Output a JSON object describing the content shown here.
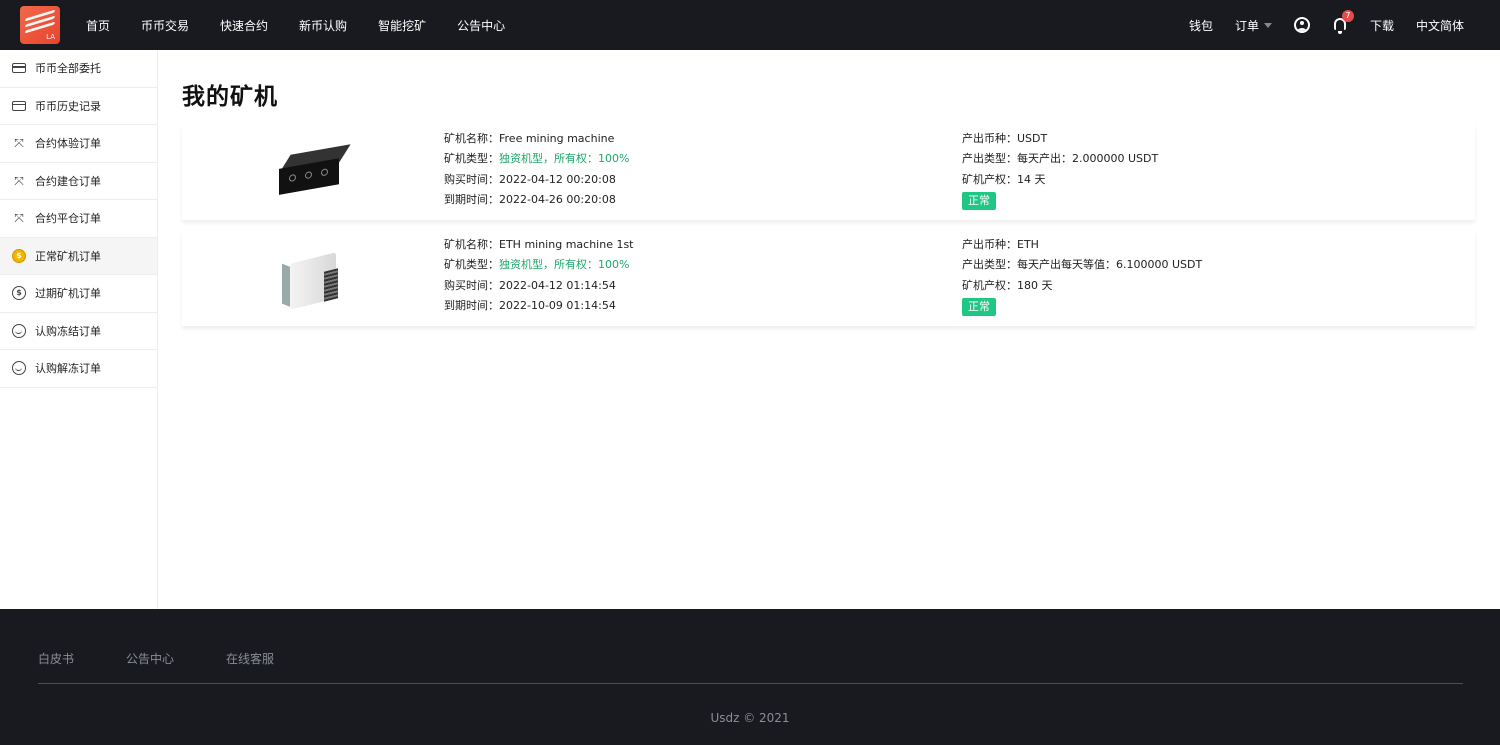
{
  "nav": {
    "logo_text": "LA",
    "links": [
      "首页",
      "币币交易",
      "快速合约",
      "新币认购",
      "智能挖矿",
      "公告中心"
    ],
    "right": {
      "wallet": "钱包",
      "orders": "订单",
      "notifications_count": "7",
      "download": "下载",
      "language": "中文简体"
    }
  },
  "sidebar": {
    "items": [
      {
        "label": "币币全部委托",
        "icon": "card-icon"
      },
      {
        "label": "币币历史记录",
        "icon": "card-icon"
      },
      {
        "label": "合约体验订单",
        "icon": "swap-icon"
      },
      {
        "label": "合约建仓订单",
        "icon": "swap-icon"
      },
      {
        "label": "合约平仓订单",
        "icon": "swap-icon"
      },
      {
        "label": "正常矿机订单",
        "icon": "coin-icon"
      },
      {
        "label": "过期矿机订单",
        "icon": "coin-icon"
      },
      {
        "label": "认购冻结订单",
        "icon": "face-icon"
      },
      {
        "label": "认购解冻订单",
        "icon": "face-icon"
      }
    ],
    "active_index": 5
  },
  "main": {
    "title": "我的矿机",
    "machines": [
      {
        "name_label": "矿机名称：",
        "name": "Free mining machine",
        "type_label": "矿机类型：",
        "type": "独资机型，所有权：100%",
        "buy_label": "购买时间：",
        "buy_time": "2022-04-12 00:20:08",
        "expire_label": "到期时间：",
        "expire_time": "2022-04-26 00:20:08",
        "coin_label": "产出币种：",
        "coin": "USDT",
        "output_label": "产出类型：",
        "output": "每天产出：2.000000 USDT",
        "term_label": "矿机产权：",
        "term": "14 天",
        "status": "正常"
      },
      {
        "name_label": "矿机名称：",
        "name": "ETH mining machine 1st",
        "type_label": "矿机类型：",
        "type": "独资机型，所有权：100%",
        "buy_label": "购买时间：",
        "buy_time": "2022-04-12 01:14:54",
        "expire_label": "到期时间：",
        "expire_time": "2022-10-09 01:14:54",
        "coin_label": "产出币种：",
        "coin": "ETH",
        "output_label": "产出类型：",
        "output": "每天产出每天等值：6.100000 USDT",
        "term_label": "矿机产权：",
        "term": "180 天",
        "status": "正常"
      }
    ]
  },
  "footer": {
    "links": [
      "白皮书",
      "公告中心",
      "在线客服"
    ],
    "copyright": "Usdz © 2021"
  },
  "colors": {
    "nav_bg": "#181a20",
    "accent_green": "#1ec784",
    "type_green": "#1ea86a",
    "badge_red": "#e84a4a"
  }
}
